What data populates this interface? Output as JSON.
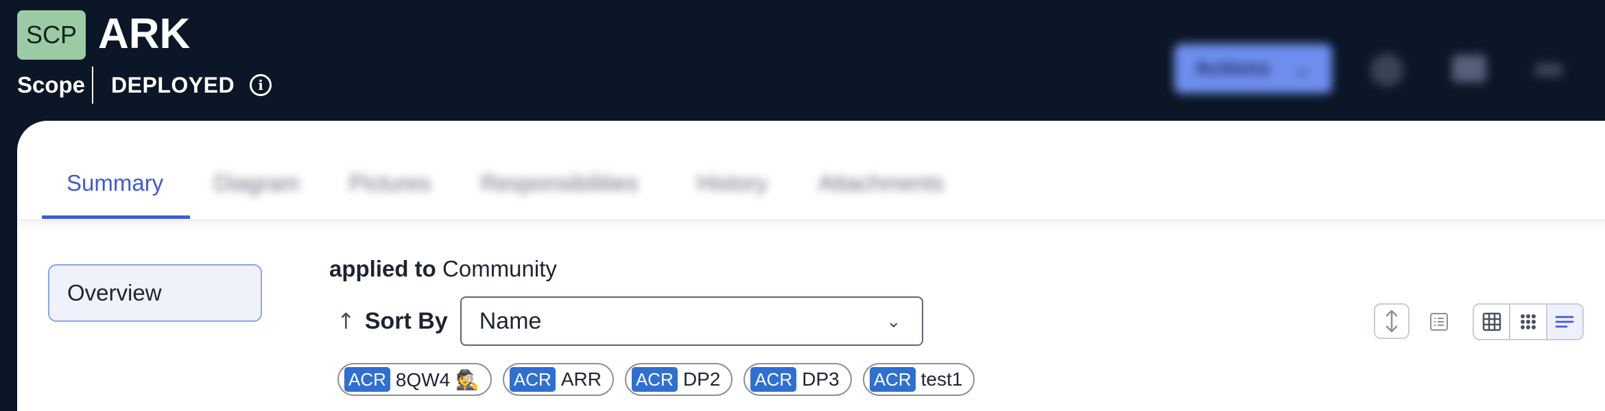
{
  "header": {
    "badge": "SCP",
    "title": "ARK",
    "scope_label": "Scope",
    "status": "DEPLOYED",
    "info_glyph": "i",
    "action_label": "Actions",
    "action_chevron": "⌄"
  },
  "tabs": [
    {
      "label": "Summary",
      "active": true
    },
    {
      "label": "Diagram"
    },
    {
      "label": "Pictures"
    },
    {
      "label": "Responsibilities"
    },
    {
      "label": "History"
    },
    {
      "label": "Attachments"
    }
  ],
  "sidebar": {
    "items": [
      {
        "label": "Overview",
        "selected": true
      }
    ]
  },
  "main": {
    "applied_prefix": "applied to",
    "applied_value": "Community",
    "sort_arrow": "↑",
    "sort_label": "Sort By",
    "sort_value": "Name",
    "sort_chevron": "⌄",
    "tags": [
      {
        "prefix": "ACR",
        "label": "8QW4 🕵️"
      },
      {
        "prefix": "ACR",
        "label": "ARR"
      },
      {
        "prefix": "ACR",
        "label": "DP2"
      },
      {
        "prefix": "ACR",
        "label": "DP3"
      },
      {
        "prefix": "ACR",
        "label": "test1"
      }
    ]
  },
  "toolbar": {
    "resize_icon": "expand-vertical-icon",
    "list_icon": "list-icon",
    "view_modes": [
      "grid-icon",
      "dots-grid-icon",
      "lines-icon"
    ],
    "selected_view": "lines-icon"
  },
  "colors": {
    "header_bg": "#0b1627",
    "badge_bg": "#9ccaa4",
    "accent": "#3e5bd8",
    "tag_prefix_bg": "#2f6fd1"
  }
}
